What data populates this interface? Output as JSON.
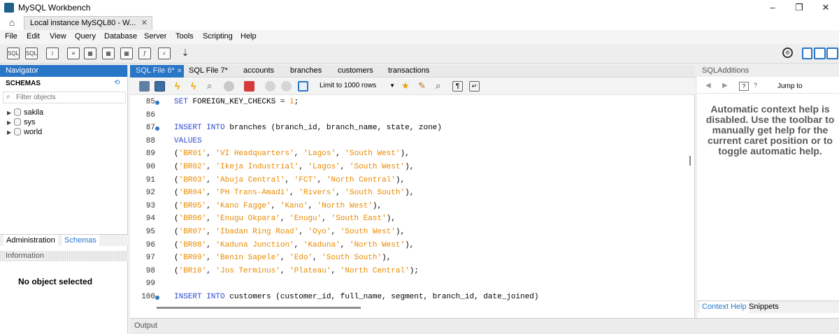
{
  "window": {
    "title": "MySQL Workbench",
    "minimize": "–",
    "maximize": "❐",
    "close": "✕"
  },
  "connection_tab": {
    "label": "Local instance MySQL80 - W...",
    "close": "✕",
    "home_icon": "home-icon"
  },
  "menu": [
    "File",
    "Edit",
    "View",
    "Query",
    "Database",
    "Server",
    "Tools",
    "Scripting",
    "Help"
  ],
  "navigator": {
    "title": "Navigator",
    "schemas_label": "SCHEMAS",
    "filter_placeholder": "Filter objects",
    "schemas": [
      "sakila",
      "sys",
      "world"
    ],
    "bottom_tabs": [
      "Administration",
      "Schemas"
    ],
    "information_label": "Information",
    "no_object": "No object selected"
  },
  "query_tabs": [
    "SQL File 6*",
    "SQL File 7*",
    "accounts",
    "branches",
    "customers",
    "transactions"
  ],
  "query_toolbar": {
    "limit_label": "Limit to 1000 rows"
  },
  "code": [
    {
      "n": "85",
      "dot": true,
      "tokens": [
        [
          "kw",
          "SET"
        ],
        [
          "pl",
          " FOREIGN_KEY_CHECKS = "
        ],
        [
          "st",
          "1"
        ],
        [
          "pl",
          ";"
        ]
      ]
    },
    {
      "n": "86",
      "dot": false,
      "tokens": []
    },
    {
      "n": "87",
      "dot": true,
      "tokens": [
        [
          "kw",
          "INSERT INTO"
        ],
        [
          "pl",
          " branches (branch_id, branch_name, state, zone)"
        ]
      ]
    },
    {
      "n": "88",
      "dot": false,
      "tokens": [
        [
          "kw",
          "VALUES"
        ]
      ]
    },
    {
      "n": "89",
      "dot": false,
      "tokens": [
        [
          "pl",
          "("
        ],
        [
          "st",
          "'BR01'"
        ],
        [
          "pl",
          ", "
        ],
        [
          "st",
          "'VI Headquarters'"
        ],
        [
          "pl",
          ", "
        ],
        [
          "st",
          "'Lagos'"
        ],
        [
          "pl",
          ", "
        ],
        [
          "st",
          "'South West'"
        ],
        [
          "pl",
          "),"
        ]
      ]
    },
    {
      "n": "90",
      "dot": false,
      "tokens": [
        [
          "pl",
          "("
        ],
        [
          "st",
          "'BR02'"
        ],
        [
          "pl",
          ", "
        ],
        [
          "st",
          "'Ikeja Industrial'"
        ],
        [
          "pl",
          ", "
        ],
        [
          "st",
          "'Lagos'"
        ],
        [
          "pl",
          ", "
        ],
        [
          "st",
          "'South West'"
        ],
        [
          "pl",
          "),"
        ]
      ]
    },
    {
      "n": "91",
      "dot": false,
      "tokens": [
        [
          "pl",
          "("
        ],
        [
          "st",
          "'BR03'"
        ],
        [
          "pl",
          ", "
        ],
        [
          "st",
          "'Abuja Central'"
        ],
        [
          "pl",
          ", "
        ],
        [
          "st",
          "'FCT'"
        ],
        [
          "pl",
          ", "
        ],
        [
          "st",
          "'North Central'"
        ],
        [
          "pl",
          "),"
        ]
      ]
    },
    {
      "n": "92",
      "dot": false,
      "tokens": [
        [
          "pl",
          "("
        ],
        [
          "st",
          "'BR04'"
        ],
        [
          "pl",
          ", "
        ],
        [
          "st",
          "'PH Trans-Amadi'"
        ],
        [
          "pl",
          ", "
        ],
        [
          "st",
          "'Rivers'"
        ],
        [
          "pl",
          ", "
        ],
        [
          "st",
          "'South South'"
        ],
        [
          "pl",
          "),"
        ]
      ]
    },
    {
      "n": "93",
      "dot": false,
      "tokens": [
        [
          "pl",
          "("
        ],
        [
          "st",
          "'BR05'"
        ],
        [
          "pl",
          ", "
        ],
        [
          "st",
          "'Kano Fagge'"
        ],
        [
          "pl",
          ", "
        ],
        [
          "st",
          "'Kano'"
        ],
        [
          "pl",
          ", "
        ],
        [
          "st",
          "'North West'"
        ],
        [
          "pl",
          "),"
        ]
      ]
    },
    {
      "n": "94",
      "dot": false,
      "tokens": [
        [
          "pl",
          "("
        ],
        [
          "st",
          "'BR06'"
        ],
        [
          "pl",
          ", "
        ],
        [
          "st",
          "'Enugu Okpara'"
        ],
        [
          "pl",
          ", "
        ],
        [
          "st",
          "'Enugu'"
        ],
        [
          "pl",
          ", "
        ],
        [
          "st",
          "'South East'"
        ],
        [
          "pl",
          "),"
        ]
      ]
    },
    {
      "n": "95",
      "dot": false,
      "tokens": [
        [
          "pl",
          "("
        ],
        [
          "st",
          "'BR07'"
        ],
        [
          "pl",
          ", "
        ],
        [
          "st",
          "'Ibadan Ring Road'"
        ],
        [
          "pl",
          ", "
        ],
        [
          "st",
          "'Oyo'"
        ],
        [
          "pl",
          ", "
        ],
        [
          "st",
          "'South West'"
        ],
        [
          "pl",
          "),"
        ]
      ]
    },
    {
      "n": "96",
      "dot": false,
      "tokens": [
        [
          "pl",
          "("
        ],
        [
          "st",
          "'BR08'"
        ],
        [
          "pl",
          ", "
        ],
        [
          "st",
          "'Kaduna Junction'"
        ],
        [
          "pl",
          ", "
        ],
        [
          "st",
          "'Kaduna'"
        ],
        [
          "pl",
          ", "
        ],
        [
          "st",
          "'North West'"
        ],
        [
          "pl",
          "),"
        ]
      ]
    },
    {
      "n": "97",
      "dot": false,
      "tokens": [
        [
          "pl",
          "("
        ],
        [
          "st",
          "'BR09'"
        ],
        [
          "pl",
          ", "
        ],
        [
          "st",
          "'Benin Sapele'"
        ],
        [
          "pl",
          ", "
        ],
        [
          "st",
          "'Edo'"
        ],
        [
          "pl",
          ", "
        ],
        [
          "st",
          "'South South'"
        ],
        [
          "pl",
          "),"
        ]
      ]
    },
    {
      "n": "98",
      "dot": false,
      "tokens": [
        [
          "pl",
          "("
        ],
        [
          "st",
          "'BR10'"
        ],
        [
          "pl",
          ", "
        ],
        [
          "st",
          "'Jos Terminus'"
        ],
        [
          "pl",
          ", "
        ],
        [
          "st",
          "'Plateau'"
        ],
        [
          "pl",
          ", "
        ],
        [
          "st",
          "'North Central'"
        ],
        [
          "pl",
          ");"
        ]
      ]
    },
    {
      "n": "99",
      "dot": false,
      "tokens": []
    },
    {
      "n": "100",
      "dot": true,
      "tokens": [
        [
          "kw",
          "INSERT INTO"
        ],
        [
          "pl",
          " customers (customer_id, full_name, segment, branch_id, date_joined)"
        ]
      ]
    }
  ],
  "sql_additions": {
    "title": "SQLAdditions",
    "jump_to": "Jump to",
    "help_lines": [
      "Automatic context help is",
      "disabled. Use the toolbar to",
      "manually get help for the",
      "current caret position or to",
      "toggle automatic help."
    ],
    "bottom_tabs": [
      "Context Help",
      "Snippets"
    ]
  },
  "output_label": "Output",
  "colors": {
    "accent": "#2a76c6",
    "keyword": "#2f4bd0",
    "string": "#e88a00"
  }
}
